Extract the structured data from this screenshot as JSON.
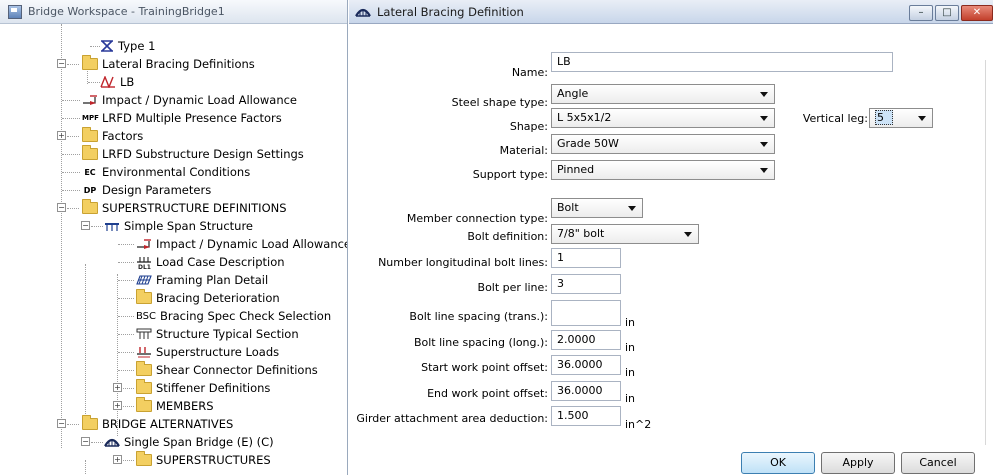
{
  "workspace": {
    "title": "Bridge Workspace - TrainingBridge1"
  },
  "tree": {
    "items": [
      {
        "label": "Type 1",
        "icon": "x-beam-icon"
      },
      {
        "label": "Lateral Bracing Definitions",
        "icon": "folder-icon"
      },
      {
        "label": "LB",
        "icon": "bracing-icon"
      },
      {
        "label": "Impact / Dynamic Load Allowance",
        "icon": "arrow-icon"
      },
      {
        "label": "LRFD Multiple Presence Factors",
        "icon": "mpf-icon",
        "tag": "MPF"
      },
      {
        "label": "Factors",
        "icon": "folder-icon"
      },
      {
        "label": "LRFD Substructure Design Settings",
        "icon": "folder-icon"
      },
      {
        "label": "Environmental Conditions",
        "icon": "ec-icon",
        "tag": "EC"
      },
      {
        "label": "Design Parameters",
        "icon": "dp-icon",
        "tag": "DP"
      },
      {
        "label": "SUPERSTRUCTURE DEFINITIONS",
        "icon": "folder-icon"
      },
      {
        "label": "Simple Span Structure",
        "icon": "span-icon"
      },
      {
        "label": "Impact / Dynamic Load Allowance",
        "icon": "arrow-icon"
      },
      {
        "label": "Load Case Description",
        "icon": "load-case-icon",
        "tag": "DL1"
      },
      {
        "label": "Framing Plan Detail",
        "icon": "framing-icon"
      },
      {
        "label": "Bracing Deterioration",
        "icon": "folder-icon"
      },
      {
        "label": "Bracing Spec Check Selection",
        "icon": "bsc-icon",
        "tag": "BSC"
      },
      {
        "label": "Structure Typical Section",
        "icon": "section-icon"
      },
      {
        "label": "Superstructure Loads",
        "icon": "loads-icon"
      },
      {
        "label": "Shear Connector Definitions",
        "icon": "folder-icon"
      },
      {
        "label": "Stiffener Definitions",
        "icon": "folder-icon"
      },
      {
        "label": "MEMBERS",
        "icon": "folder-icon"
      },
      {
        "label": "BRIDGE ALTERNATIVES",
        "icon": "folder-icon"
      },
      {
        "label": "Single Span Bridge (E) (C)",
        "icon": "bridge-icon"
      },
      {
        "label": "SUPERSTRUCTURES",
        "icon": "folder-icon"
      }
    ]
  },
  "dialog": {
    "title": "Lateral Bracing Definition",
    "title_buttons": {
      "minimize": "–",
      "maximize": "□",
      "close": "✕"
    },
    "fields": {
      "name": {
        "label": "Name:",
        "value": "LB"
      },
      "steel_shape_type": {
        "label": "Steel shape type:",
        "value": "Angle"
      },
      "shape": {
        "label": "Shape:",
        "value": "L 5x5x1/2"
      },
      "vertical_leg": {
        "label": "Vertical leg:",
        "value": "5"
      },
      "material": {
        "label": "Material:",
        "value": "Grade 50W"
      },
      "support_type": {
        "label": "Support type:",
        "value": "Pinned"
      },
      "member_connection_type": {
        "label": "Member connection type:",
        "value": "Bolt"
      },
      "bolt_definition": {
        "label": "Bolt definition:",
        "value": "7/8\" bolt"
      },
      "num_long_bolt_lines": {
        "label": "Number longitudinal bolt lines:",
        "value": "1"
      },
      "bolt_per_line": {
        "label": "Bolt per line:",
        "value": "3"
      },
      "bolt_line_spacing_trans": {
        "label": "Bolt line spacing (trans.):",
        "value": "",
        "unit": "in"
      },
      "bolt_line_spacing_long": {
        "label": "Bolt line spacing (long.):",
        "value": "2.0000",
        "unit": "in"
      },
      "start_wp_offset": {
        "label": "Start work point offset:",
        "value": "36.0000",
        "unit": "in"
      },
      "end_wp_offset": {
        "label": "End work point offset:",
        "value": "36.0000",
        "unit": "in"
      },
      "girder_attach_deduction": {
        "label": "Girder attachment area deduction:",
        "value": "1.500",
        "unit": "in^2"
      }
    },
    "buttons": {
      "ok": "OK",
      "apply": "Apply",
      "cancel": "Cancel"
    }
  }
}
